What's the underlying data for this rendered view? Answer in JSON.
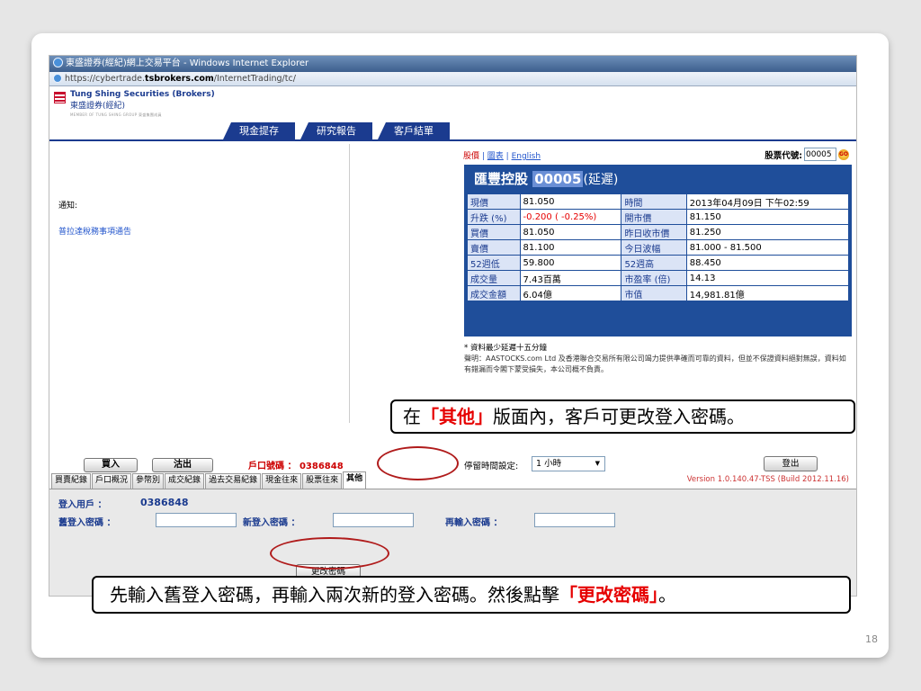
{
  "window": {
    "title": "東盛證券(經紀)網上交易平台 - Windows Internet Explorer",
    "url_prefix": "https://cybertrade.",
    "url_domain": "tsbrokers.com",
    "url_path": "/InternetTrading/tc/"
  },
  "logo": {
    "name_en": "Tung Shing Securities (Brokers)",
    "name_zh": "東盛證券(經紀)",
    "tagline": "MEMBER OF TUNG SHING GROUP 東盛集團成員"
  },
  "nav": {
    "tabs": [
      "現金提存",
      "研究報告",
      "客戶結單"
    ]
  },
  "notice": {
    "label": "通知:",
    "link": "普拉達稅務事項通告"
  },
  "quote": {
    "links": [
      "股價",
      "圖表",
      "English"
    ],
    "separator": " | ",
    "code_label": "股票代號:",
    "code_value": "00005",
    "go_icon_text": "GO",
    "stock_name": "匯豐控股",
    "stock_code": "00005",
    "delay_tag": "(延遲)",
    "rows": [
      [
        "現價",
        "81.050",
        "時間",
        "2013年04月09日 下午02:59"
      ],
      [
        "升跌 (%)",
        "-0.200 ( -0.25%)",
        "開市價",
        "81.150"
      ],
      [
        "買價",
        "81.050",
        "昨日收市價",
        "81.250"
      ],
      [
        "賣價",
        "81.100",
        "今日波幅",
        "81.000 - 81.500"
      ],
      [
        "52週低",
        "59.800",
        "52週高",
        "88.450"
      ],
      [
        "成交量",
        "7.43百萬",
        "市盈率 (倍)",
        "14.13"
      ],
      [
        "成交金額",
        "6.04億",
        "市值",
        "14,981.81億"
      ]
    ],
    "delay_note": "* 資料最少延遲十五分鐘",
    "disclaimer": "聲明：AASTOCKS.com Ltd 及香港聯合交易所有限公司竭力提供準確而可靠的資料，但並不保證資料絕對無誤，資料如有錯漏而令閣下蒙受損失，本公司概不負責。"
  },
  "callouts": {
    "top_before": "在",
    "top_highlight": "「其他」",
    "top_after": "版面內，客戶可更改登入密碼。",
    "bottom_before": "先輸入舊登入密碼，再輸入兩次新的登入密碼。然後點擊",
    "bottom_highlight": "「更改密碼」",
    "bottom_after": "。"
  },
  "trade": {
    "buy_label": "買入",
    "sell_label": "沽出",
    "account_label": "戶口號碼 ： 0386848",
    "timeout_label": "停留時間設定:",
    "timeout_value": "1 小時",
    "logout_label": "登出",
    "version": "Version 1.0.140.47-TSS (Build 2012.11.16)"
  },
  "subtabs": [
    "買賣紀錄",
    "戶口概況",
    "參幣別",
    "成交紀錄",
    "過去交易紀錄",
    "現金往來",
    "股票往來",
    "其他"
  ],
  "password_form": {
    "user_label": "登入用戶 ：",
    "user_value": "0386848",
    "old_label": "舊登入密碼 ：",
    "new_label": "新登入密碼 ：",
    "confirm_label": "再輸入密碼 ：",
    "change_button": "更改密碼"
  },
  "slide": {
    "page_number": "18"
  },
  "colors": {
    "brand_blue": "#1b3b8f",
    "highlight_red": "#e60000",
    "ring_red": "#b01b1b"
  }
}
